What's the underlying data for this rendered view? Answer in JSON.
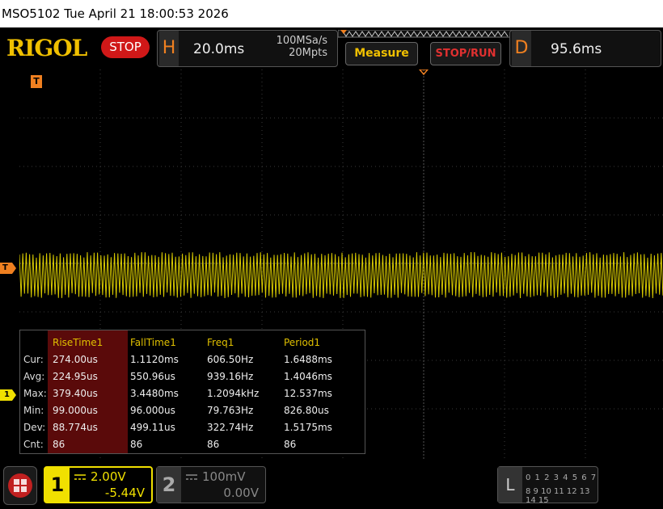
{
  "title_bar": {
    "text": "MSO5102  Tue April 21 18:00:53 2026"
  },
  "top": {
    "logo": "RIGOL",
    "run_state": "STOP",
    "horizontal": {
      "letter": "H",
      "timebase": "20.0ms",
      "sample_rate": "100MSa/s",
      "memory_depth": "20Mpts"
    },
    "measure_label": "Measure",
    "stoprun_label": "STOP/RUN",
    "delay": {
      "letter": "D",
      "value": "95.6ms"
    }
  },
  "markers": {
    "trigger_top": "T",
    "trigger_level": "T",
    "channel1": "1"
  },
  "measurements": {
    "headers": [
      "RiseTime1",
      "FallTime1",
      "Freq1",
      "Period1"
    ],
    "rows": [
      {
        "label": "Cur:",
        "values": [
          "274.00us",
          "1.1120ms",
          "606.50Hz",
          "1.6488ms"
        ]
      },
      {
        "label": "Avg:",
        "values": [
          "224.95us",
          "550.96us",
          "939.16Hz",
          "1.4046ms"
        ]
      },
      {
        "label": "Max:",
        "values": [
          "379.40us",
          "3.4480ms",
          "1.2094kHz",
          "12.537ms"
        ]
      },
      {
        "label": "Min:",
        "values": [
          "99.000us",
          "96.000us",
          "79.763Hz",
          "826.80us"
        ]
      },
      {
        "label": "Dev:",
        "values": [
          "88.774us",
          "499.11us",
          "322.74Hz",
          "1.5175ms"
        ]
      },
      {
        "label": "Cnt:",
        "values": [
          "86",
          "86",
          "86",
          "86"
        ]
      }
    ]
  },
  "channels": {
    "ch1": {
      "number": "1",
      "scale": "2.00V",
      "offset": "-5.44V",
      "color": "#f0e000"
    },
    "ch2": {
      "number": "2",
      "scale": "100mV",
      "offset": "0.00V",
      "color": "#888888"
    }
  },
  "logic": {
    "letter": "L",
    "row1": "0 1 2 3  4 5 6 7",
    "row2": "8 9 10 11 12 13 14 15"
  },
  "colors": {
    "accent": "#f08020",
    "trace": "#f0e000",
    "stop": "#d01818",
    "highlight": "#5a0a0a"
  }
}
